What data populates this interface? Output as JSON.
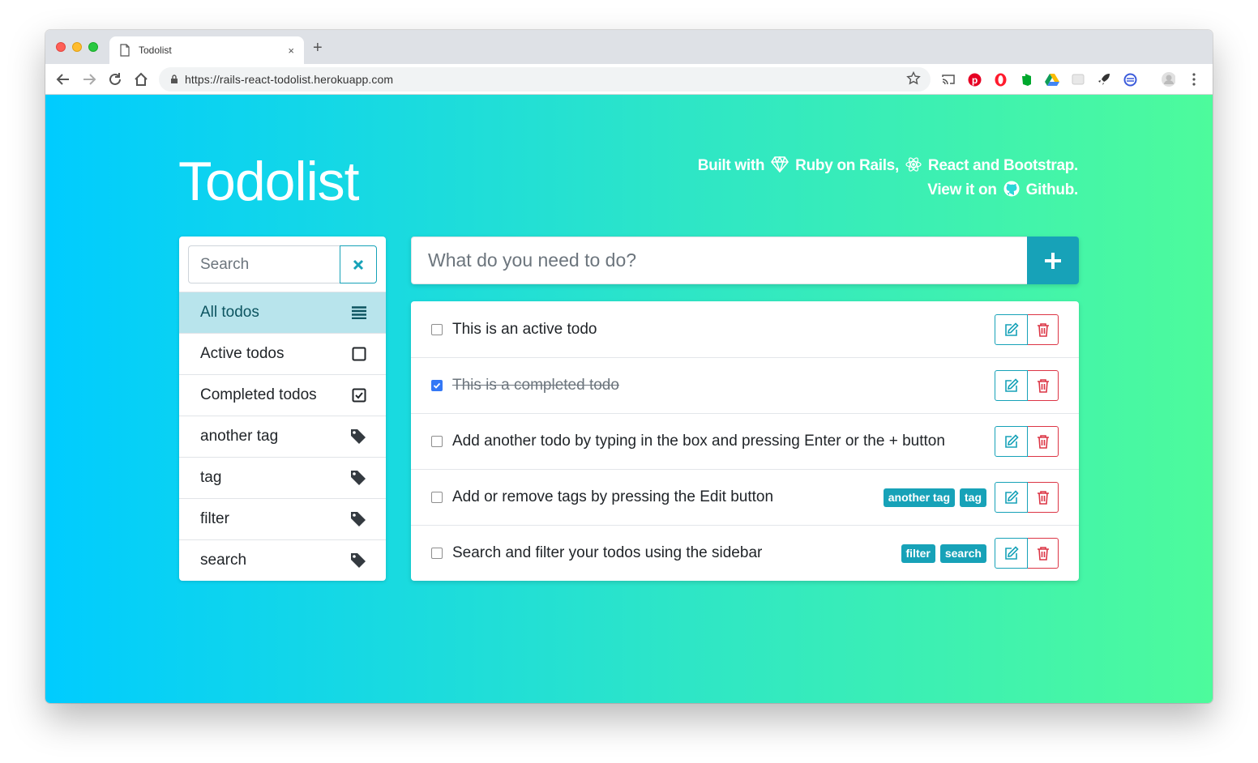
{
  "browser": {
    "tab_title": "Todolist",
    "tab_close": "×",
    "new_tab": "+",
    "url": "https://rails-react-todolist.herokuapp.com"
  },
  "header": {
    "title": "Todolist",
    "built_with": "Built with",
    "ruby": "Ruby on Rails,",
    "react": "React and Bootstrap.",
    "view_it_on": "View it on",
    "github": "Github."
  },
  "sidebar": {
    "search_placeholder": "Search",
    "items": [
      {
        "label": "All todos",
        "icon": "list-icon",
        "active": true
      },
      {
        "label": "Active todos",
        "icon": "square-icon"
      },
      {
        "label": "Completed todos",
        "icon": "check-square-icon"
      },
      {
        "label": "another tag",
        "icon": "tag-icon"
      },
      {
        "label": "tag",
        "icon": "tag-icon"
      },
      {
        "label": "filter",
        "icon": "tag-icon"
      },
      {
        "label": "search",
        "icon": "tag-icon"
      }
    ]
  },
  "new_todo": {
    "placeholder": "What do you need to do?",
    "add_icon": "plus-icon"
  },
  "todos": [
    {
      "text": "This is an active todo",
      "done": false,
      "tags": []
    },
    {
      "text": "This is a completed todo",
      "done": true,
      "tags": []
    },
    {
      "text": "Add another todo by typing in the box and pressing Enter or the + button",
      "done": false,
      "tags": []
    },
    {
      "text": "Add or remove tags by pressing the Edit button",
      "done": false,
      "tags": [
        "another tag",
        "tag"
      ]
    },
    {
      "text": "Search and filter your todos using the sidebar",
      "done": false,
      "tags": [
        "filter",
        "search"
      ]
    }
  ],
  "colors": {
    "accent": "#17a2b8",
    "danger": "#dc3545",
    "gradient_start": "#00ccff",
    "gradient_end": "#4dfb9c"
  }
}
